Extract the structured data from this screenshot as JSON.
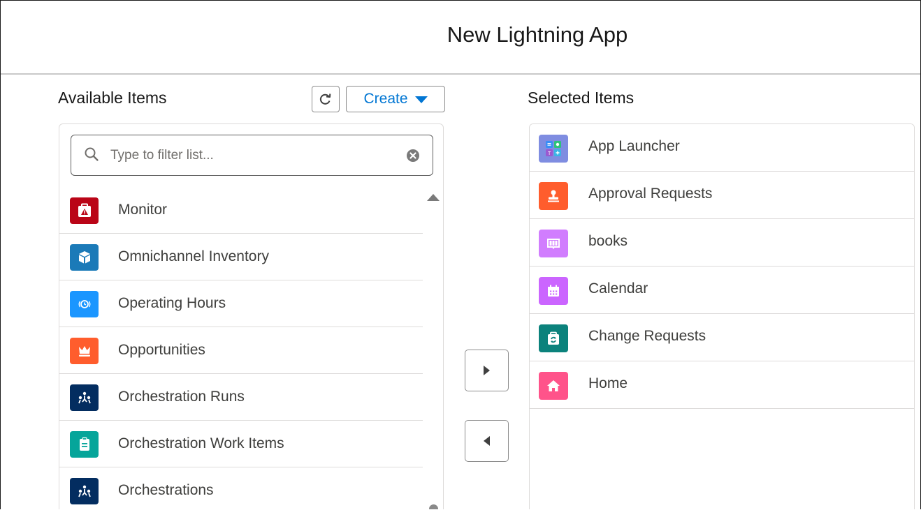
{
  "modal": {
    "title": "New Lightning App"
  },
  "available": {
    "label": "Available Items",
    "create_label": "Create",
    "search": {
      "placeholder": "Type to filter list...",
      "value": ""
    },
    "items": [
      {
        "label": "Monitor",
        "icon": "monitor-icon",
        "color": "#ba0517"
      },
      {
        "label": "Omnichannel Inventory",
        "icon": "cube-icon",
        "color": "#1b7ab8"
      },
      {
        "label": "Operating Hours",
        "icon": "clock-icon",
        "color": "#1b96ff"
      },
      {
        "label": "Opportunities",
        "icon": "crown-icon",
        "color": "#ff5d2d"
      },
      {
        "label": "Orchestration Runs",
        "icon": "orchestration-icon",
        "color": "#032d60"
      },
      {
        "label": "Orchestration Work Items",
        "icon": "clipboard-icon",
        "color": "#06a59a"
      },
      {
        "label": "Orchestrations",
        "icon": "orchestration-icon",
        "color": "#032d60"
      }
    ]
  },
  "selected": {
    "label": "Selected Items",
    "items": [
      {
        "label": "App Launcher",
        "icon": "app-launcher-icon",
        "color": "#7f8de1"
      },
      {
        "label": "Approval Requests",
        "icon": "approval-stamp-icon",
        "color": "#ff5d2d"
      },
      {
        "label": "books",
        "icon": "book-icon",
        "color": "#d17dfe"
      },
      {
        "label": "Calendar",
        "icon": "calendar-icon",
        "color": "#cb65ff"
      },
      {
        "label": "Change Requests",
        "icon": "change-request-icon",
        "color": "#0b827c"
      },
      {
        "label": "Home",
        "icon": "home-icon",
        "color": "#ff538a"
      }
    ]
  }
}
